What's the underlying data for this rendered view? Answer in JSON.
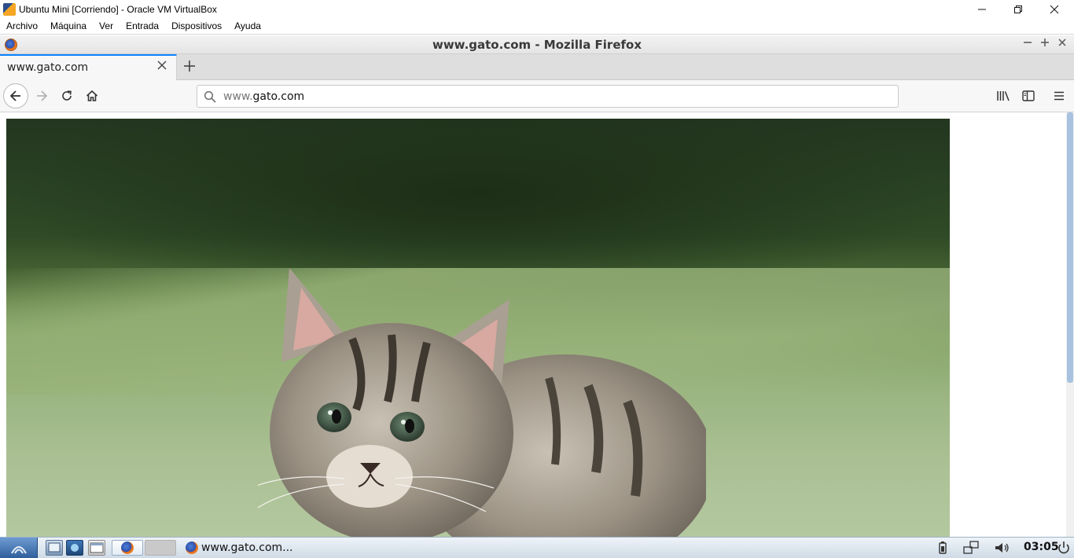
{
  "vbox": {
    "title": "Ubuntu Mini [Corriendo] - Oracle VM VirtualBox",
    "menu": [
      "Archivo",
      "Máquina",
      "Ver",
      "Entrada",
      "Dispositivos",
      "Ayuda"
    ]
  },
  "firefox": {
    "window_title": "www.gato.com - Mozilla Firefox",
    "tab_title": "www.gato.com",
    "url": {
      "prefix": "www.",
      "host": "gato.com"
    }
  },
  "content": {
    "image_name": "kitten-photo"
  },
  "taskbar": {
    "task_label": "www.gato.com...",
    "clock": "03:05"
  },
  "colors": {
    "accent": "#0a84ff",
    "scroll_thumb": "#a8c2e0"
  }
}
